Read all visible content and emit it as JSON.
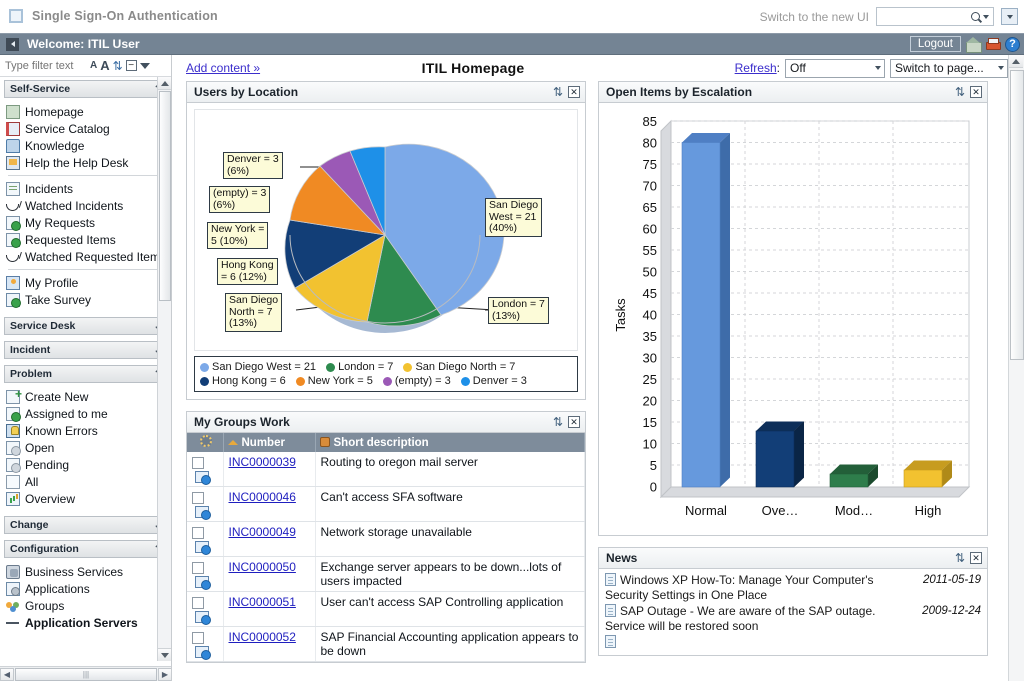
{
  "sso": {
    "title": "Single Sign-On Authentication",
    "switch_label": "Switch to the new UI",
    "search_value": "",
    "search_placeholder": ""
  },
  "welcome": {
    "title": "Welcome: ITIL User",
    "logout_label": "Logout",
    "icons": [
      "home-icon",
      "print-icon",
      "help-icon"
    ]
  },
  "sidebar": {
    "filter_placeholder": "Type filter text",
    "toolbar_icons": [
      "font-small-icon",
      "font-large-icon",
      "refresh-icon",
      "collapse-all-icon",
      "caret-down-icon"
    ],
    "sections": [
      {
        "label": "Self-Service",
        "expanded": true,
        "chevron": "⌃",
        "groups": [
          [
            {
              "label": "Homepage",
              "icon": "home-icon"
            },
            {
              "label": "Service Catalog",
              "icon": "catalog-icon"
            },
            {
              "label": "Knowledge",
              "icon": "knowledge-icon"
            },
            {
              "label": "Help the Help Desk",
              "icon": "helpdesk-icon"
            }
          ],
          [
            {
              "label": "Incidents",
              "icon": "incident-icon"
            },
            {
              "label": "Watched Incidents",
              "icon": "watch-icon"
            },
            {
              "label": "My Requests",
              "icon": "request-icon"
            },
            {
              "label": "Requested Items",
              "icon": "request-icon"
            },
            {
              "label": "Watched Requested Items",
              "icon": "watch-icon"
            }
          ],
          [
            {
              "label": "My Profile",
              "icon": "profile-icon"
            },
            {
              "label": "Take Survey",
              "icon": "survey-icon"
            }
          ]
        ]
      },
      {
        "label": "Service Desk",
        "expanded": false,
        "chevron": "⌄",
        "groups": []
      },
      {
        "label": "Incident",
        "expanded": false,
        "chevron": "⌄",
        "groups": []
      },
      {
        "label": "Problem",
        "expanded": true,
        "chevron": "⌃",
        "groups": [
          [
            {
              "label": "Create New",
              "icon": "new-icon"
            },
            {
              "label": "Assigned to me",
              "icon": "assigned-icon"
            },
            {
              "label": "Known Errors",
              "icon": "known-errors-icon"
            },
            {
              "label": "Open",
              "icon": "open-icon"
            },
            {
              "label": "Pending",
              "icon": "pending-icon"
            },
            {
              "label": "All",
              "icon": "all-icon"
            },
            {
              "label": "Overview",
              "icon": "overview-icon"
            }
          ]
        ]
      },
      {
        "label": "Change",
        "expanded": false,
        "chevron": "⌄",
        "groups": []
      },
      {
        "label": "Configuration",
        "expanded": true,
        "chevron": "⌃",
        "groups": [
          [
            {
              "label": "Business Services",
              "icon": "business-services-icon"
            },
            {
              "label": "Applications",
              "icon": "applications-icon"
            },
            {
              "label": "Groups",
              "icon": "groups-icon"
            },
            {
              "label": "Application Servers",
              "icon": "app-servers-icon"
            }
          ]
        ]
      }
    ]
  },
  "toolbar": {
    "add_content": "Add content »",
    "page_title": "ITIL Homepage",
    "refresh_label": "Refresh",
    "refresh_value": "Off",
    "switch_page_value": "Switch to page..."
  },
  "panels": {
    "users_by_location": {
      "title": "Users by Location"
    },
    "open_items": {
      "title": "Open Items by Escalation"
    },
    "my_groups_work": {
      "title": "My Groups Work"
    },
    "news": {
      "title": "News"
    }
  },
  "chart_data": [
    {
      "type": "pie",
      "title": "Users by Location",
      "labels": [
        "San Diego West",
        "London",
        "San Diego North",
        "Hong Kong",
        "New York",
        "(empty)",
        "Denver"
      ],
      "values": [
        21,
        7,
        7,
        6,
        5,
        3,
        3
      ],
      "percents": [
        40,
        13,
        13,
        12,
        10,
        6,
        6
      ],
      "colors": [
        "#7CA9E8",
        "#2E8B4F",
        "#F2C230",
        "#123E77",
        "#F08A23",
        "#9B59B6",
        "#1E90E8"
      ],
      "callouts": [
        {
          "text": "Denver = 3\n(6%)"
        },
        {
          "text": "(empty) = 3\n(6%)"
        },
        {
          "text": "New York =\n5 (10%)"
        },
        {
          "text": "Hong Kong\n= 6 (12%)"
        },
        {
          "text": "San Diego\nNorth = 7\n(13%)"
        },
        {
          "text": "San Diego\nWest = 21\n(40%)"
        },
        {
          "text": "London = 7\n(13%)"
        }
      ],
      "legend": [
        {
          "label": "San Diego West = 21",
          "color": "#7CA9E8"
        },
        {
          "label": "London = 7",
          "color": "#2E8B4F"
        },
        {
          "label": "San Diego North = 7",
          "color": "#F2C230"
        },
        {
          "label": "Hong Kong = 6",
          "color": "#123E77"
        },
        {
          "label": "New York = 5",
          "color": "#F08A23"
        },
        {
          "label": "(empty) = 3",
          "color": "#9B59B6"
        },
        {
          "label": "Denver = 3",
          "color": "#1E90E8"
        }
      ],
      "legend_position": "bottom"
    },
    {
      "type": "bar",
      "title": "Open Items by Escalation",
      "categories": [
        "Normal",
        "Ove...",
        "Mod...",
        "High"
      ],
      "values": [
        80,
        13,
        3,
        4
      ],
      "colors": [
        "#6699DD",
        "#123E77",
        "#2E7D4B",
        "#F2C230"
      ],
      "xlabel": "",
      "ylabel": "Tasks",
      "ylim": [
        0,
        85
      ],
      "yticks": [
        0,
        5,
        10,
        15,
        20,
        25,
        30,
        35,
        40,
        45,
        50,
        55,
        60,
        65,
        70,
        75,
        80,
        85
      ],
      "grid": true,
      "legend_position": "none"
    }
  ],
  "groups_work": {
    "columns": [
      "",
      "Number",
      "Short description"
    ],
    "column_icons": [
      "gear-icon",
      "sort-asc-icon",
      "cube-icon"
    ],
    "rows": [
      {
        "number": "INC0000039",
        "description": "Routing to oregon mail server"
      },
      {
        "number": "INC0000046",
        "description": "Can't access SFA software"
      },
      {
        "number": "INC0000049",
        "description": "Network storage unavailable"
      },
      {
        "number": "INC0000050",
        "description": "Exchange server appears to be down...lots of users impacted"
      },
      {
        "number": "INC0000051",
        "description": "User can't access SAP Controlling application"
      },
      {
        "number": "INC0000052",
        "description": "SAP Financial Accounting application appears to be down"
      }
    ]
  },
  "news": {
    "items": [
      {
        "text": "Windows XP How-To: Manage Your Computer's Security Settings in One Place",
        "date": "2011-05-19"
      },
      {
        "text": "SAP Outage - We are aware of the SAP outage. Service will be restored soon",
        "date": "2009-12-24"
      }
    ]
  }
}
